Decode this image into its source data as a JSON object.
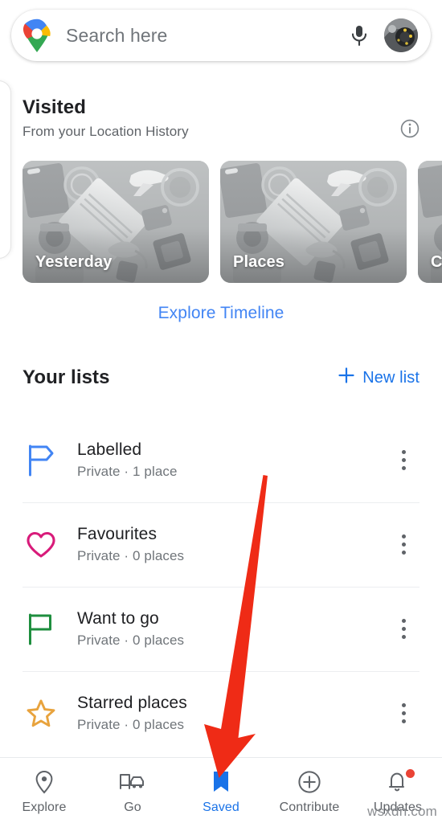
{
  "search": {
    "placeholder": "Search here",
    "value": "",
    "logo_icon": "google-maps-pin-icon",
    "mic_icon": "microphone-icon",
    "avatar_icon": "user-avatar"
  },
  "visited": {
    "title": "Visited",
    "subtitle": "From your Location History",
    "info_icon": "info-icon",
    "cards": [
      {
        "label": "Yesterday"
      },
      {
        "label": "Places"
      },
      {
        "label": "C"
      }
    ],
    "explore_link": "Explore Timeline"
  },
  "your_lists": {
    "title": "Your lists",
    "new_list_label": "New list",
    "new_list_icon": "plus-icon",
    "items": [
      {
        "name": "Labelled",
        "meta": "Private · 1 place",
        "icon": "flag-tag-icon",
        "icon_color": "#4285f4",
        "menu_icon": "more-vertical-icon"
      },
      {
        "name": "Favourites",
        "meta": "Private · 0 places",
        "icon": "heart-icon",
        "icon_color": "#d81b7a",
        "menu_icon": "more-vertical-icon"
      },
      {
        "name": "Want to go",
        "meta": "Private · 0 places",
        "icon": "flag-icon",
        "icon_color": "#1e8e3e",
        "menu_icon": "more-vertical-icon"
      },
      {
        "name": "Starred places",
        "meta": "Private · 0 places",
        "icon": "star-icon",
        "icon_color": "#e8a33d",
        "menu_icon": "more-vertical-icon"
      }
    ]
  },
  "bottom_nav": {
    "active": "Saved",
    "items": [
      {
        "label": "Explore",
        "icon": "location-pin-icon",
        "active": false,
        "badge": false
      },
      {
        "label": "Go",
        "icon": "commute-icon",
        "active": false,
        "badge": false
      },
      {
        "label": "Saved",
        "icon": "bookmark-icon",
        "active": true,
        "badge": false
      },
      {
        "label": "Contribute",
        "icon": "plus-circle-icon",
        "active": false,
        "badge": false
      },
      {
        "label": "Updates",
        "icon": "bell-icon",
        "active": false,
        "badge": true
      }
    ]
  },
  "annotation": {
    "type": "red-arrow",
    "color": "#ef2b16",
    "points_to": "Saved"
  },
  "watermark": "wsxdn.com",
  "colors": {
    "google_blue": "#4285f4",
    "link_blue": "#1a73e8",
    "active_blue": "#1a73e8",
    "annotation_red": "#ef2b16",
    "badge_red": "#ea4335"
  }
}
